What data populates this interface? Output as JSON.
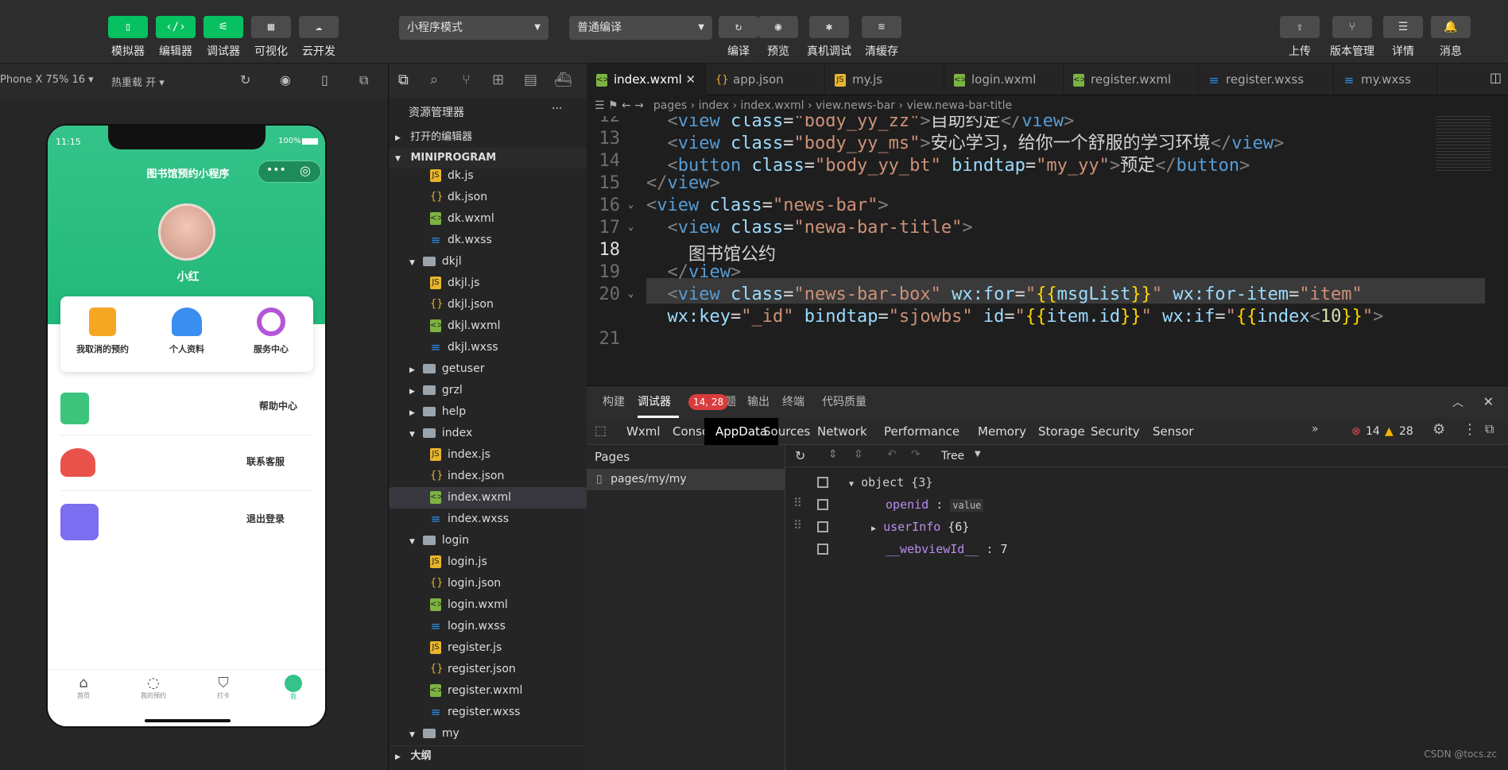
{
  "toolbar": {
    "left_buttons": [
      {
        "label": "模拟器",
        "glyph": "▯"
      },
      {
        "label": "编辑器",
        "glyph": "‹/›"
      },
      {
        "label": "调试器",
        "glyph": "⚟"
      },
      {
        "label": "可视化",
        "glyph": "▦"
      },
      {
        "label": "云开发",
        "glyph": "☁"
      }
    ],
    "mode_select": "小程序模式",
    "compile_select": "普通编译",
    "center_buttons": [
      {
        "label": "编译",
        "glyph": "↻"
      },
      {
        "label": "预览",
        "glyph": "◉"
      },
      {
        "label": "真机调试",
        "glyph": "✱"
      },
      {
        "label": "清缓存",
        "glyph": "≋"
      }
    ],
    "right_buttons": [
      {
        "label": "上传",
        "glyph": "⇪"
      },
      {
        "label": "版本管理",
        "glyph": "⑂"
      },
      {
        "label": "详情",
        "glyph": "☰"
      },
      {
        "label": "消息",
        "glyph": "🔔"
      }
    ]
  },
  "simulator_bar": {
    "device": "Phone X 75% 16 ▾",
    "hot_reload": "热重载 开 ▾"
  },
  "phone": {
    "time": "11:15",
    "battery": "100%",
    "nav_title": "图书馆预约小程序",
    "username": "小红",
    "cards": [
      {
        "label": "我取消的预约",
        "color": "#f5a623"
      },
      {
        "label": "个人资料",
        "color": "#3a8ef0"
      },
      {
        "label": "服务中心",
        "color": "#b455d8"
      }
    ],
    "menu": [
      {
        "label": "帮助中心",
        "color": "#3cc47c"
      },
      {
        "label": "联系客服",
        "color": "#e9524a"
      },
      {
        "label": "退出登录",
        "color": "#7b6ef0"
      }
    ],
    "tabbar": [
      "首页",
      "我的预约",
      "打卡",
      "我"
    ]
  },
  "explorer": {
    "header": "资源管理器",
    "more": "···",
    "open_editors": "打开的编辑器",
    "project": "MINIPROGRAM",
    "outline": "大纲",
    "tree": [
      {
        "name": "dk.js",
        "type": "js",
        "indent": 2
      },
      {
        "name": "dk.json",
        "type": "json",
        "indent": 2
      },
      {
        "name": "dk.wxml",
        "type": "wxml",
        "indent": 2
      },
      {
        "name": "dk.wxss",
        "type": "wxss",
        "indent": 2
      },
      {
        "name": "dkjl",
        "type": "folder-open",
        "indent": 1
      },
      {
        "name": "dkjl.js",
        "type": "js",
        "indent": 2
      },
      {
        "name": "dkjl.json",
        "type": "json",
        "indent": 2
      },
      {
        "name": "dkjl.wxml",
        "type": "wxml",
        "indent": 2
      },
      {
        "name": "dkjl.wxss",
        "type": "wxss",
        "indent": 2
      },
      {
        "name": "getuser",
        "type": "folder",
        "indent": 1
      },
      {
        "name": "grzl",
        "type": "folder",
        "indent": 1
      },
      {
        "name": "help",
        "type": "folder",
        "indent": 1
      },
      {
        "name": "index",
        "type": "folder-open",
        "indent": 1
      },
      {
        "name": "index.js",
        "type": "js",
        "indent": 2
      },
      {
        "name": "index.json",
        "type": "json",
        "indent": 2
      },
      {
        "name": "index.wxml",
        "type": "wxml",
        "indent": 2,
        "selected": true
      },
      {
        "name": "index.wxss",
        "type": "wxss",
        "indent": 2
      },
      {
        "name": "login",
        "type": "folder-open",
        "indent": 1
      },
      {
        "name": "login.js",
        "type": "js",
        "indent": 2
      },
      {
        "name": "login.json",
        "type": "json",
        "indent": 2
      },
      {
        "name": "login.wxml",
        "type": "wxml",
        "indent": 2
      },
      {
        "name": "login.wxss",
        "type": "wxss",
        "indent": 2
      },
      {
        "name": "register.js",
        "type": "js",
        "indent": 2
      },
      {
        "name": "register.json",
        "type": "json",
        "indent": 2
      },
      {
        "name": "register.wxml",
        "type": "wxml",
        "indent": 2
      },
      {
        "name": "register.wxss",
        "type": "wxss",
        "indent": 2
      },
      {
        "name": "my",
        "type": "folder-open",
        "indent": 1
      }
    ]
  },
  "editor": {
    "tabs": [
      {
        "name": "index.wxml",
        "type": "wxml",
        "active": true
      },
      {
        "name": "app.json",
        "type": "json"
      },
      {
        "name": "my.js",
        "type": "js"
      },
      {
        "name": "login.wxml",
        "type": "wxml"
      },
      {
        "name": "register.wxml",
        "type": "wxml"
      },
      {
        "name": "register.wxss",
        "type": "wxss"
      },
      {
        "name": "my.wxss",
        "type": "wxss"
      }
    ],
    "breadcrumb": [
      "pages",
      "index",
      "index.wxml",
      "view.news-bar",
      "view.newa-bar-title"
    ],
    "line_numbers": [
      "12",
      "13",
      "14",
      "15",
      "16",
      "17",
      "18",
      "19",
      "20",
      "",
      "21"
    ],
    "current_line": "18"
  },
  "debugger": {
    "tabs": [
      "构建",
      "调试器",
      "问题",
      "输出",
      "终端",
      "代码质量"
    ],
    "badge": "14, 28",
    "devtools_tabs": [
      "Wxml",
      "Console",
      "AppData",
      "Sources",
      "Network",
      "Performance",
      "Memory",
      "Storage",
      "Security",
      "Sensor"
    ],
    "errors": "14",
    "warnings": "28",
    "pages_header": "Pages",
    "page_item": "pages/my/my",
    "view_mode": "Tree",
    "tree": {
      "root": "object {3}",
      "openid_key": "openid",
      "openid_value": "value",
      "userinfo_key": "userInfo",
      "userinfo_value": "{6}",
      "webview_key": "__webviewId__",
      "webview_value": "7"
    },
    "watermark": "CSDN @tocs.zc"
  }
}
